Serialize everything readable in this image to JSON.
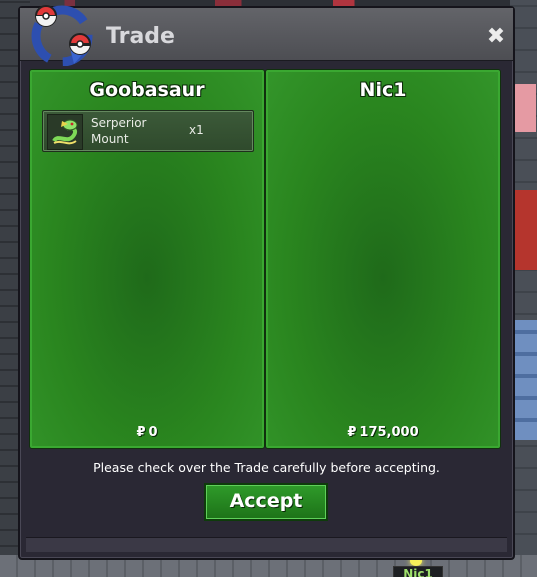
{
  "window": {
    "title": "Trade",
    "close_glyph": "✖"
  },
  "traders": [
    {
      "name": "Goobasaur",
      "items": [
        {
          "name": "Serperior Mount",
          "quantity": "x1",
          "icon": "serperior-icon"
        }
      ],
      "money_symbol": "₽",
      "money": "0"
    },
    {
      "name": "Nic1",
      "items": [],
      "money_symbol": "₽",
      "money": "175,000"
    }
  ],
  "notice": "Please check over the Trade carefully before accepting.",
  "accept_label": "Accept",
  "npc_label": "Nic1",
  "colors": {
    "panel_green": "#2a861f",
    "accept_green": "#2f9b2a",
    "window_bg": "#2a2834"
  }
}
